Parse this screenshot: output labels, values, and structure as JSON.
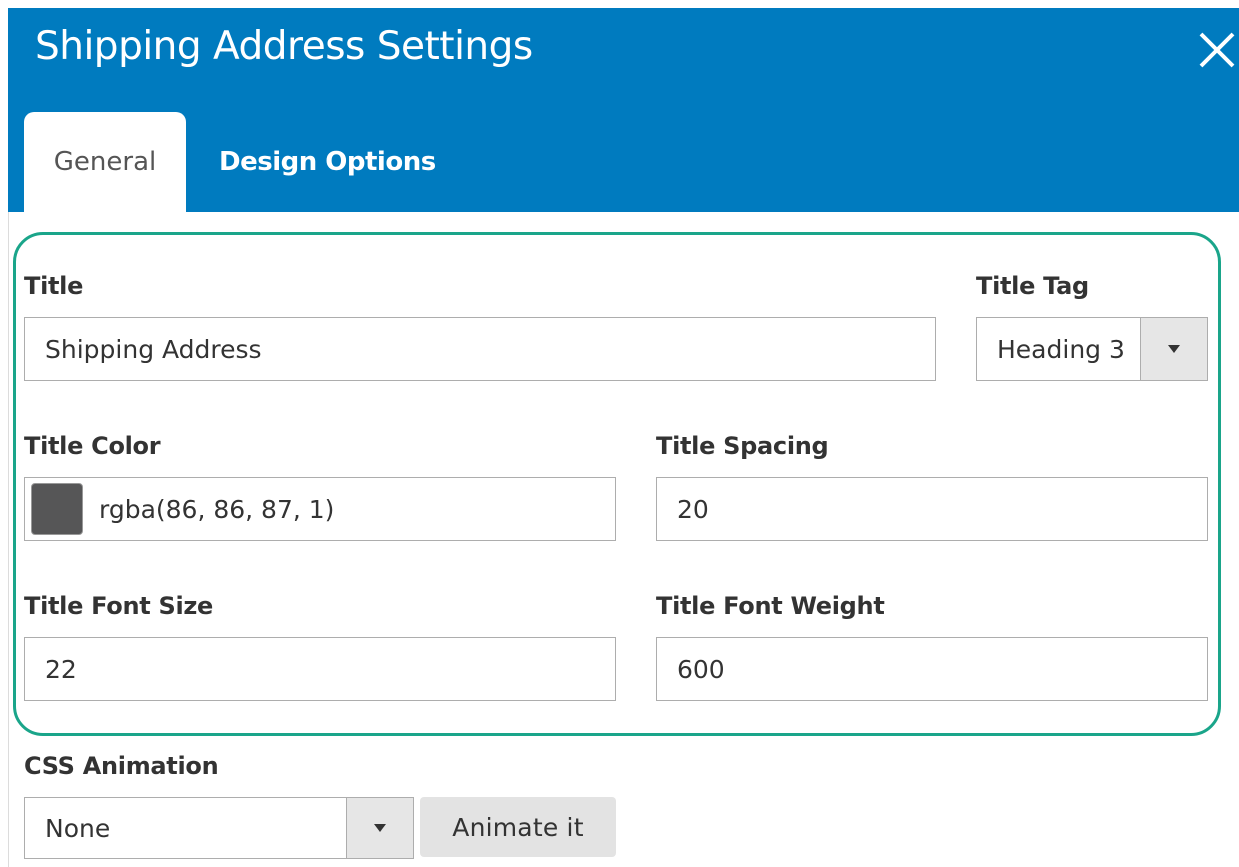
{
  "modal": {
    "title": "Shipping Address Settings",
    "close_icon": "close-icon"
  },
  "tabs": [
    {
      "label": "General",
      "active": true
    },
    {
      "label": "Design Options",
      "active": false
    }
  ],
  "form": {
    "title": {
      "label": "Title",
      "value": "Shipping Address"
    },
    "title_tag": {
      "label": "Title Tag",
      "value": "Heading 3"
    },
    "title_color": {
      "label": "Title Color",
      "value": "rgba(86, 86, 87, 1)",
      "swatch": "#565657"
    },
    "title_spacing": {
      "label": "Title Spacing",
      "value": "20"
    },
    "title_font_size": {
      "label": "Title Font Size",
      "value": "22"
    },
    "title_font_weight": {
      "label": "Title Font Weight",
      "value": "600"
    },
    "css_animation": {
      "label": "CSS Animation",
      "value": "None",
      "button": "Animate it"
    }
  },
  "colors": {
    "header": "#007bbf",
    "highlight": "#1aa58a"
  }
}
